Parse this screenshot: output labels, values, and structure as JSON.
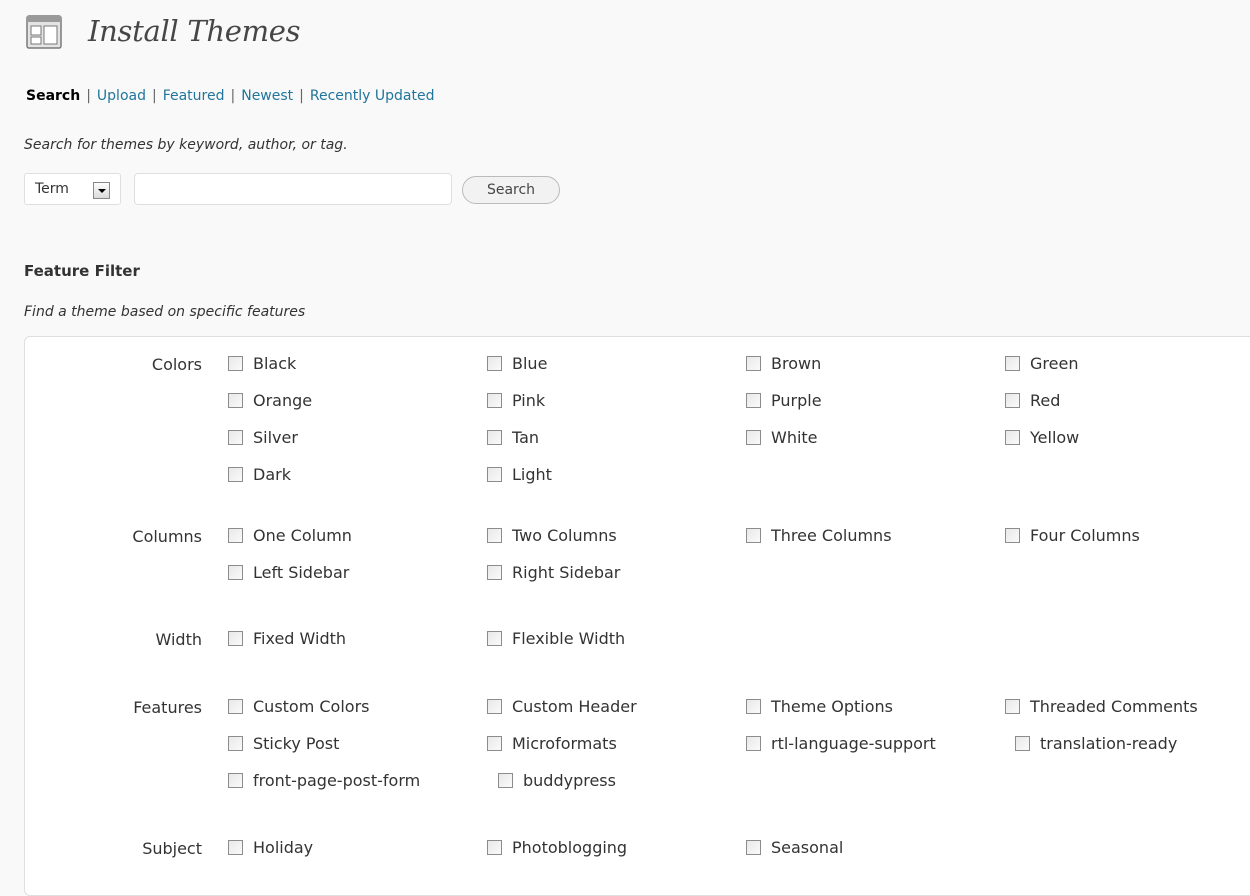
{
  "header": {
    "title": "Install Themes",
    "icon": "appearance-themes-icon"
  },
  "subnav": {
    "items": [
      {
        "label": "Search",
        "current": true
      },
      {
        "label": "Upload",
        "current": false
      },
      {
        "label": "Featured",
        "current": false
      },
      {
        "label": "Newest",
        "current": false
      },
      {
        "label": "Recently Updated",
        "current": false
      }
    ],
    "separator": "|"
  },
  "search": {
    "description": "Search for themes by keyword, author, or tag.",
    "type_select": {
      "selected": "Term"
    },
    "input": {
      "value": "",
      "placeholder": ""
    },
    "button_label": "Search"
  },
  "feature_filter": {
    "heading": "Feature Filter",
    "description": "Find a theme based on specific features",
    "groups": [
      {
        "label": "Colors",
        "options": [
          "Black",
          "Blue",
          "Brown",
          "Green",
          "Orange",
          "Pink",
          "Purple",
          "Red",
          "Silver",
          "Tan",
          "White",
          "Yellow",
          "Dark",
          "Light"
        ]
      },
      {
        "label": "Columns",
        "options": [
          "One Column",
          "Two Columns",
          "Three Columns",
          "Four Columns",
          "Left Sidebar",
          "Right Sidebar"
        ]
      },
      {
        "label": "Width",
        "options": [
          "Fixed Width",
          "Flexible Width"
        ]
      },
      {
        "label": "Features",
        "options": [
          "Custom Colors",
          "Custom Header",
          "Theme Options",
          "Threaded Comments",
          "Sticky Post",
          "Microformats",
          "rtl-language-support",
          "translation-ready",
          "front-page-post-form",
          "buddypress"
        ]
      },
      {
        "label": "Subject",
        "options": [
          "Holiday",
          "Photoblogging",
          "Seasonal"
        ]
      }
    ]
  },
  "colors": {
    "link": "#21759b",
    "background": "#f9f9f9",
    "panel": "#ffffff",
    "border": "#dfdfdf"
  }
}
